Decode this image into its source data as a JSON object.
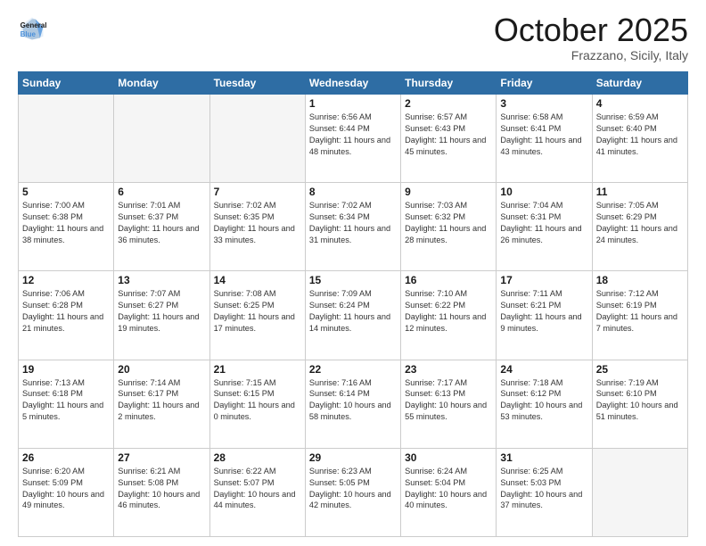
{
  "header": {
    "logo_line1": "General",
    "logo_line2": "Blue",
    "month": "October 2025",
    "location": "Frazzano, Sicily, Italy"
  },
  "days_of_week": [
    "Sunday",
    "Monday",
    "Tuesday",
    "Wednesday",
    "Thursday",
    "Friday",
    "Saturday"
  ],
  "weeks": [
    [
      {
        "day": "",
        "sunrise": "",
        "sunset": "",
        "daylight": ""
      },
      {
        "day": "",
        "sunrise": "",
        "sunset": "",
        "daylight": ""
      },
      {
        "day": "",
        "sunrise": "",
        "sunset": "",
        "daylight": ""
      },
      {
        "day": "1",
        "sunrise": "6:56 AM",
        "sunset": "6:44 PM",
        "daylight": "11 hours and 48 minutes."
      },
      {
        "day": "2",
        "sunrise": "6:57 AM",
        "sunset": "6:43 PM",
        "daylight": "11 hours and 45 minutes."
      },
      {
        "day": "3",
        "sunrise": "6:58 AM",
        "sunset": "6:41 PM",
        "daylight": "11 hours and 43 minutes."
      },
      {
        "day": "4",
        "sunrise": "6:59 AM",
        "sunset": "6:40 PM",
        "daylight": "11 hours and 41 minutes."
      }
    ],
    [
      {
        "day": "5",
        "sunrise": "7:00 AM",
        "sunset": "6:38 PM",
        "daylight": "11 hours and 38 minutes."
      },
      {
        "day": "6",
        "sunrise": "7:01 AM",
        "sunset": "6:37 PM",
        "daylight": "11 hours and 36 minutes."
      },
      {
        "day": "7",
        "sunrise": "7:02 AM",
        "sunset": "6:35 PM",
        "daylight": "11 hours and 33 minutes."
      },
      {
        "day": "8",
        "sunrise": "7:02 AM",
        "sunset": "6:34 PM",
        "daylight": "11 hours and 31 minutes."
      },
      {
        "day": "9",
        "sunrise": "7:03 AM",
        "sunset": "6:32 PM",
        "daylight": "11 hours and 28 minutes."
      },
      {
        "day": "10",
        "sunrise": "7:04 AM",
        "sunset": "6:31 PM",
        "daylight": "11 hours and 26 minutes."
      },
      {
        "day": "11",
        "sunrise": "7:05 AM",
        "sunset": "6:29 PM",
        "daylight": "11 hours and 24 minutes."
      }
    ],
    [
      {
        "day": "12",
        "sunrise": "7:06 AM",
        "sunset": "6:28 PM",
        "daylight": "11 hours and 21 minutes."
      },
      {
        "day": "13",
        "sunrise": "7:07 AM",
        "sunset": "6:27 PM",
        "daylight": "11 hours and 19 minutes."
      },
      {
        "day": "14",
        "sunrise": "7:08 AM",
        "sunset": "6:25 PM",
        "daylight": "11 hours and 17 minutes."
      },
      {
        "day": "15",
        "sunrise": "7:09 AM",
        "sunset": "6:24 PM",
        "daylight": "11 hours and 14 minutes."
      },
      {
        "day": "16",
        "sunrise": "7:10 AM",
        "sunset": "6:22 PM",
        "daylight": "11 hours and 12 minutes."
      },
      {
        "day": "17",
        "sunrise": "7:11 AM",
        "sunset": "6:21 PM",
        "daylight": "11 hours and 9 minutes."
      },
      {
        "day": "18",
        "sunrise": "7:12 AM",
        "sunset": "6:19 PM",
        "daylight": "11 hours and 7 minutes."
      }
    ],
    [
      {
        "day": "19",
        "sunrise": "7:13 AM",
        "sunset": "6:18 PM",
        "daylight": "11 hours and 5 minutes."
      },
      {
        "day": "20",
        "sunrise": "7:14 AM",
        "sunset": "6:17 PM",
        "daylight": "11 hours and 2 minutes."
      },
      {
        "day": "21",
        "sunrise": "7:15 AM",
        "sunset": "6:15 PM",
        "daylight": "11 hours and 0 minutes."
      },
      {
        "day": "22",
        "sunrise": "7:16 AM",
        "sunset": "6:14 PM",
        "daylight": "10 hours and 58 minutes."
      },
      {
        "day": "23",
        "sunrise": "7:17 AM",
        "sunset": "6:13 PM",
        "daylight": "10 hours and 55 minutes."
      },
      {
        "day": "24",
        "sunrise": "7:18 AM",
        "sunset": "6:12 PM",
        "daylight": "10 hours and 53 minutes."
      },
      {
        "day": "25",
        "sunrise": "7:19 AM",
        "sunset": "6:10 PM",
        "daylight": "10 hours and 51 minutes."
      }
    ],
    [
      {
        "day": "26",
        "sunrise": "6:20 AM",
        "sunset": "5:09 PM",
        "daylight": "10 hours and 49 minutes."
      },
      {
        "day": "27",
        "sunrise": "6:21 AM",
        "sunset": "5:08 PM",
        "daylight": "10 hours and 46 minutes."
      },
      {
        "day": "28",
        "sunrise": "6:22 AM",
        "sunset": "5:07 PM",
        "daylight": "10 hours and 44 minutes."
      },
      {
        "day": "29",
        "sunrise": "6:23 AM",
        "sunset": "5:05 PM",
        "daylight": "10 hours and 42 minutes."
      },
      {
        "day": "30",
        "sunrise": "6:24 AM",
        "sunset": "5:04 PM",
        "daylight": "10 hours and 40 minutes."
      },
      {
        "day": "31",
        "sunrise": "6:25 AM",
        "sunset": "5:03 PM",
        "daylight": "10 hours and 37 minutes."
      },
      {
        "day": "",
        "sunrise": "",
        "sunset": "",
        "daylight": ""
      }
    ]
  ]
}
